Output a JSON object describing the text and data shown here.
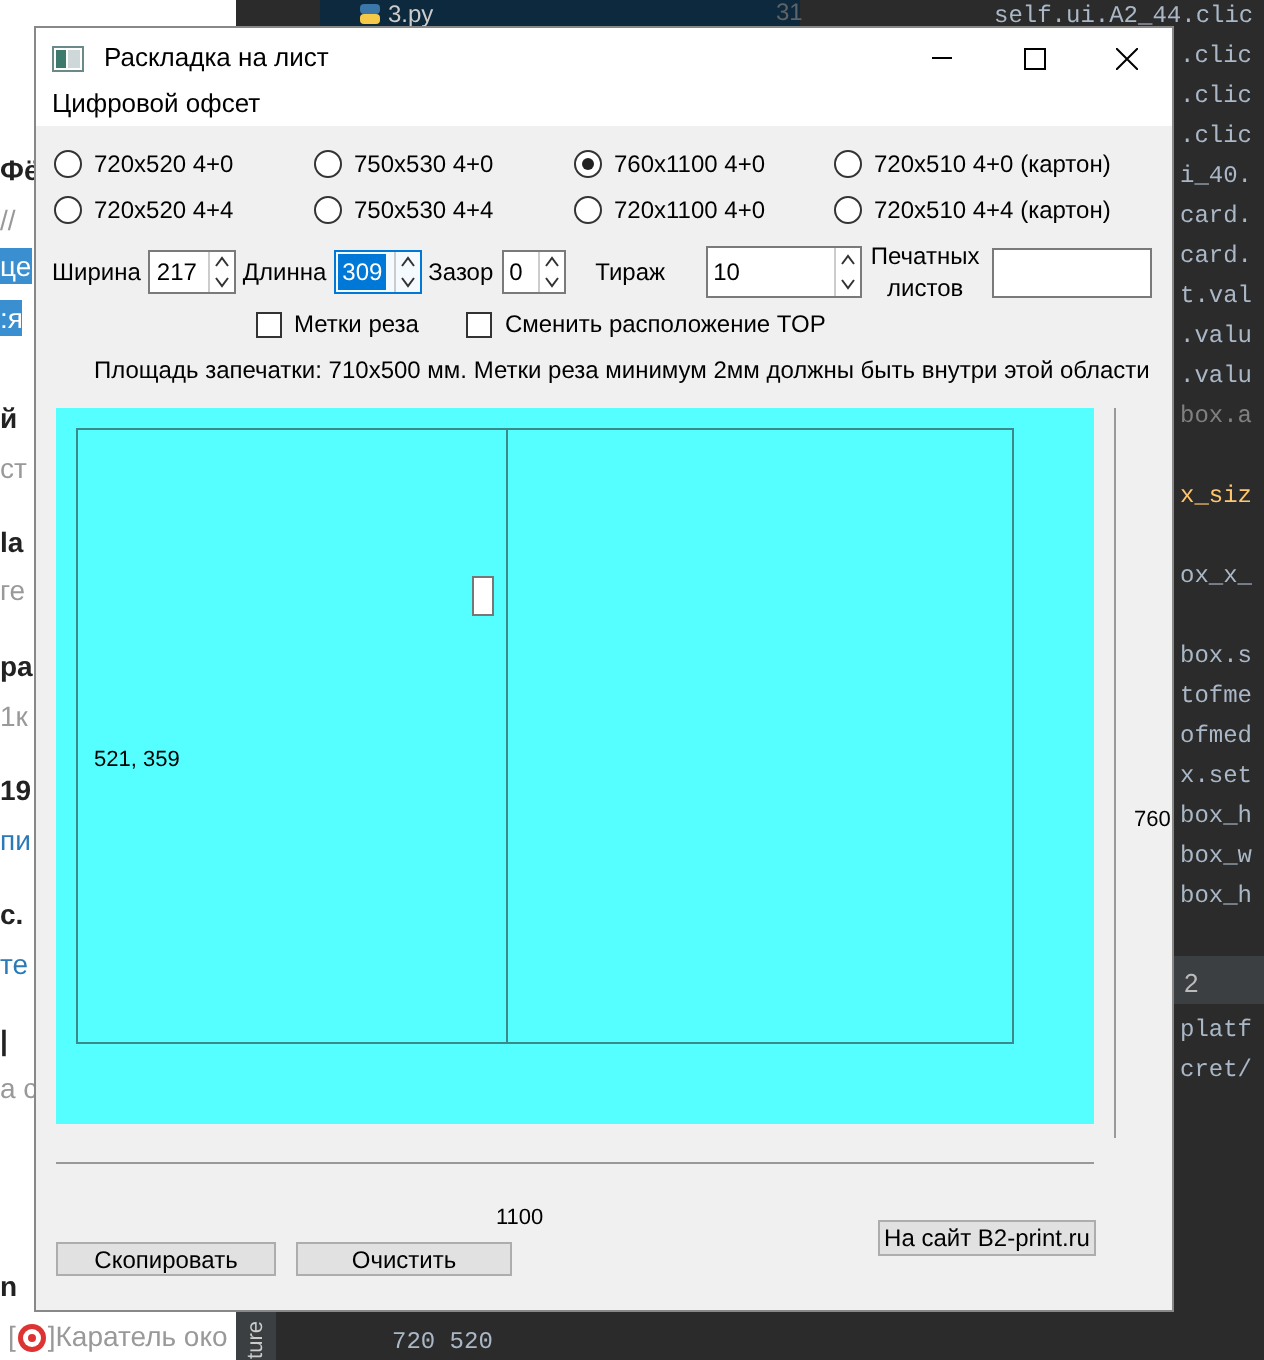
{
  "background": {
    "browser_fragments": [
      {
        "text": "Фё",
        "kind": "bold"
      },
      {
        "text": "//",
        "kind": "gray"
      },
      {
        "text": "це",
        "kind": "highlight"
      },
      {
        "text": ":я",
        "kind": "highlight"
      },
      {
        "text": "й",
        "kind": "bold"
      },
      {
        "text": "ст",
        "kind": "gray"
      },
      {
        "text": "la",
        "kind": "bold"
      },
      {
        "text": "ге",
        "kind": "gray"
      },
      {
        "text": "ра",
        "kind": "bold"
      },
      {
        "text": "1к",
        "kind": "gray"
      },
      {
        "text": "19",
        "kind": "bold"
      },
      {
        "text": "пи",
        "kind": "link"
      },
      {
        "text": "с.",
        "kind": "bold"
      },
      {
        "text": "те",
        "kind": "link"
      },
      {
        "text": "|",
        "kind": "bold"
      },
      {
        "text": "а с",
        "kind": "gray"
      },
      {
        "text": "n",
        "kind": "bold"
      }
    ],
    "bottom_line": "[",
    "bottom_line_end": "]Каратель око",
    "editor_tab": "3.py",
    "line_number": "31",
    "editor_groups": [
      {
        "lines": [
          {
            "text": "self.ui.A2_44.clic",
            "color": "#a9b7c6"
          },
          {
            "text": ".clic",
            "color": "#a9b7c6"
          },
          {
            "text": ".clic",
            "color": "#a9b7c6"
          },
          {
            "text": ".clic",
            "color": "#a9b7c6"
          },
          {
            "text": "i_40.",
            "color": "#a9b7c6"
          },
          {
            "text": "card.",
            "color": "#a9b7c6"
          },
          {
            "text": "card.",
            "color": "#a9b7c6"
          },
          {
            "text": "t.val",
            "color": "#a9b7c6"
          },
          {
            "text": ".valu",
            "color": "#a9b7c6"
          },
          {
            "text": ".valu",
            "color": "#a9b7c6"
          },
          {
            "text": "box.a",
            "color": "#808080"
          }
        ]
      },
      {
        "lines": [
          {
            "text": "x_siz",
            "color": "#ffc66d"
          }
        ]
      },
      {
        "lines": [
          {
            "text": "ox_x_",
            "color": "#a9b7c6"
          }
        ]
      },
      {
        "lines": [
          {
            "text": "box.s",
            "color": "#a9b7c6"
          },
          {
            "text": "tofme",
            "color": "#a9b7c6"
          },
          {
            "text": "ofmed",
            "color": "#a9b7c6"
          },
          {
            "text": "x.set",
            "color": "#a9b7c6"
          },
          {
            "text": "box_h",
            "color": "#a9b7c6"
          },
          {
            "text": "box_w",
            "color": "#a9b7c6"
          },
          {
            "text": "box_h",
            "color": "#a9b7c6"
          }
        ]
      }
    ],
    "terminal_tab": "2",
    "terminal_lines": [
      "platf",
      "cret/"
    ],
    "side_label": "ture",
    "output_lines": [
      "720 520"
    ]
  },
  "window": {
    "title": "Раскладка на лист"
  },
  "menu": [
    "Цифровой офсет"
  ],
  "formats": [
    {
      "label": "720x520 4+0",
      "selected": false
    },
    {
      "label": "750x530 4+0",
      "selected": false
    },
    {
      "label": "760x1100 4+0",
      "selected": true
    },
    {
      "label": "720x510 4+0 (картон)",
      "selected": false
    },
    {
      "label": "720x520 4+4",
      "selected": false
    },
    {
      "label": "750x530 4+4",
      "selected": false
    },
    {
      "label": "720x1100 4+0",
      "selected": false
    },
    {
      "label": "720x510 4+4 (картон)",
      "selected": false
    }
  ],
  "fields": [
    {
      "label": "Ширина",
      "value": "217",
      "kind": "spin",
      "focused": false
    },
    {
      "label": "Длинна",
      "value": "309",
      "kind": "spin",
      "focused": true
    },
    {
      "label": "Зазор",
      "value": "0",
      "kind": "spin",
      "focused": false
    },
    {
      "label": "Тираж",
      "value": "10",
      "kind": "wide-spin",
      "focused": false
    },
    {
      "label": "Печатных листов",
      "kind": "text",
      "focused": false
    }
  ],
  "options": [
    {
      "label": "Метки реза",
      "checked": false
    },
    {
      "label": "Сменить расположение TOP",
      "checked": false
    }
  ],
  "info": "Площадь запечатки: 710x500 мм. Метки реза минимум 2мм должны быть внутри этой области",
  "layout": {
    "piece_label": "521, 359",
    "height_label": "760",
    "width_label": "1100"
  },
  "buttons": [
    {
      "label": "Скопировать",
      "kind": "left"
    },
    {
      "label": "Очистить",
      "kind": "left"
    },
    {
      "label": "На сайт B2-print.ru",
      "kind": "right"
    }
  ]
}
